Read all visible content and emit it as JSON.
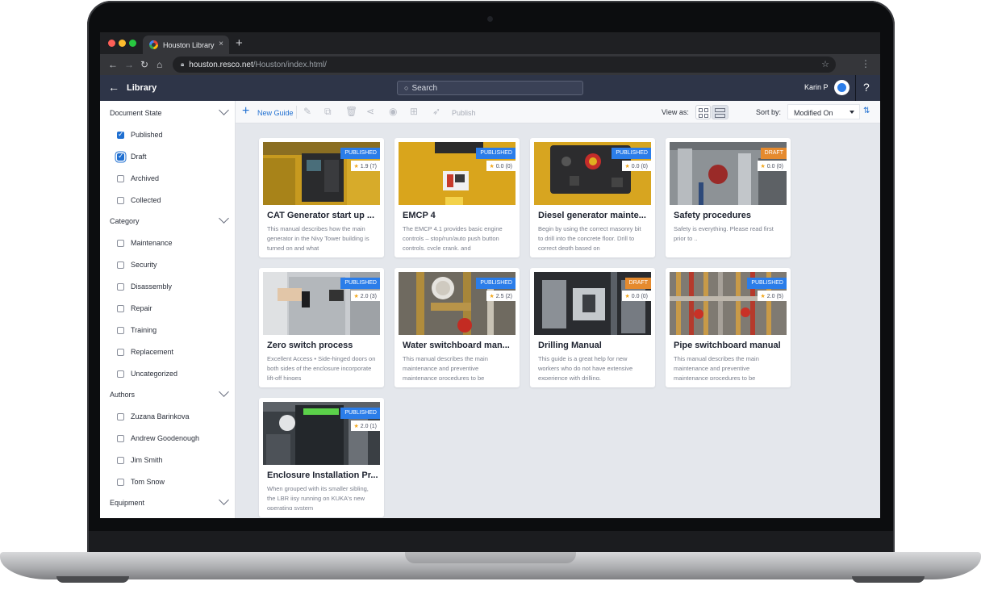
{
  "browser": {
    "tab_title": "Houston Library",
    "tab_close": "×",
    "new_tab": "+",
    "url_host": "houston.resco.net",
    "url_path": "/Houston/index.html/"
  },
  "header": {
    "back_label": "Library",
    "search_placeholder": "Search",
    "user_name": "Karin P",
    "help": "?"
  },
  "sidebar": {
    "document_state": {
      "title": "Document State",
      "options": [
        {
          "label": "Published",
          "checked": true
        },
        {
          "label": "Draft",
          "checked": true
        },
        {
          "label": "Archived",
          "checked": false
        },
        {
          "label": "Collected",
          "checked": false
        }
      ]
    },
    "category": {
      "title": "Category",
      "options": [
        "Maintenance",
        "Security",
        "Disassembly",
        "Repair",
        "Training",
        "Replacement",
        "Uncategorized"
      ]
    },
    "authors": {
      "title": "Authors",
      "options": [
        "Zuzana Barinkova",
        "Andrew Goodenough",
        "Jim Smith",
        "Tom Snow"
      ]
    },
    "equipment": {
      "title": "Equipment"
    }
  },
  "toolbar": {
    "new_guide": "New Guide",
    "publish": "Publish",
    "view_as": "View as:",
    "sort_by": "Sort by:",
    "sort_value": "Modified On"
  },
  "cards": [
    {
      "title": "CAT Generator start up ...",
      "status": "PUBLISHED",
      "rating": "1.9 (7)",
      "desc": "This manual describes how the main generator in the Nivy Tower building is turned on and what"
    },
    {
      "title": "EMCP 4",
      "status": "PUBLISHED",
      "rating": "0.0 (0)",
      "desc": "The EMCP 4.1 provides basic engine controls – stop/run/auto push button controls, cycle crank, and"
    },
    {
      "title": "Diesel generator mainte...",
      "status": "PUBLISHED",
      "rating": "0.0 (0)",
      "desc": "Begin by using the correct masonry bit to drill into the concrete floor. Drill to correct depth based on"
    },
    {
      "title": "Safety procedures",
      "status": "DRAFT",
      "rating": "0.0 (0)",
      "desc": "Safety is everything. Please read first prior to .."
    },
    {
      "title": "Zero switch process",
      "status": "PUBLISHED",
      "rating": "2.0 (3)",
      "desc": "Excellent Access • Side-hinged doors on both sides of the enclosure incorporate lift-off hinges"
    },
    {
      "title": "Water switchboard man...",
      "status": "PUBLISHED",
      "rating": "2.5 (2)",
      "desc": "This manual describes the main maintenance and preventive maintenance procedures to be"
    },
    {
      "title": "Drilling Manual",
      "status": "DRAFT",
      "rating": "0.0 (0)",
      "desc": "This guide is a great help for new workers who do not have extensive experience with drilling."
    },
    {
      "title": "Pipe switchboard manual",
      "status": "PUBLISHED",
      "rating": "2.0 (5)",
      "desc": "This manual describes the main maintenance and preventive maintenance procedures to be"
    },
    {
      "title": "Enclosure Installation Pr...",
      "status": "PUBLISHED",
      "rating": "2.0 (1)",
      "desc": "When grouped with its smaller sibling, the LBR iisy running on KUKA's new operating system"
    }
  ]
}
